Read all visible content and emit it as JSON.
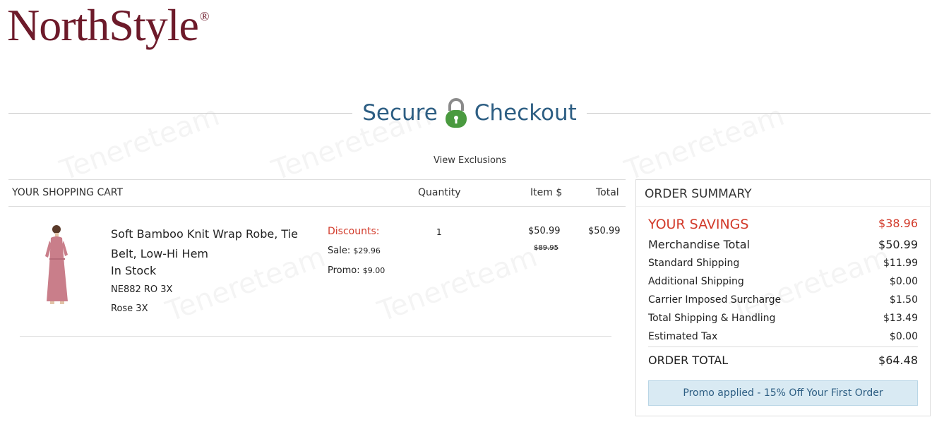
{
  "logo": {
    "text": "NorthStyle",
    "mark": "®"
  },
  "header": {
    "title_left": "Secure",
    "title_right": "Checkout",
    "view_exclusions": "View Exclusions"
  },
  "cart": {
    "heading": "YOUR SHOPPING CART",
    "col_quantity": "Quantity",
    "col_item": "Item $",
    "col_total": "Total",
    "item": {
      "name": "Soft Bamboo Knit Wrap Robe, Tie Belt, Low-Hi Hem",
      "stock": "In Stock",
      "sku": "NE882 RO 3X",
      "color": "Rose 3X",
      "discounts_label": "Discounts:",
      "sale_label": "Sale:",
      "sale_value": "$29.96",
      "promo_label": "Promo:",
      "promo_value": "$9.00",
      "quantity": "1",
      "price": "$50.99",
      "original_price": "$89.95",
      "total": "$50.99"
    }
  },
  "summary": {
    "heading": "ORDER SUMMARY",
    "savings_label": "YOUR SAVINGS",
    "savings_value": "$38.96",
    "merch_label": "Merchandise Total",
    "merch_value": "$50.99",
    "rows": [
      {
        "label": "Standard Shipping",
        "value": "$11.99"
      },
      {
        "label": "Additional Shipping",
        "value": "$0.00"
      },
      {
        "label": "Carrier Imposed Surcharge",
        "value": "$1.50"
      },
      {
        "label": "Total Shipping & Handling",
        "value": "$13.49"
      },
      {
        "label": "Estimated Tax",
        "value": "$0.00"
      }
    ],
    "total_label": "ORDER TOTAL",
    "total_value": "$64.48",
    "promo_text": "Promo applied - 15% Off Your First Order"
  },
  "watermark": "Tenereteam",
  "colors": {
    "brand": "#6d1a2a",
    "accent": "#2d5e83",
    "discount": "#d23a2a",
    "lock_green": "#4a9a3f",
    "promo_bg": "#d9eaf3"
  }
}
